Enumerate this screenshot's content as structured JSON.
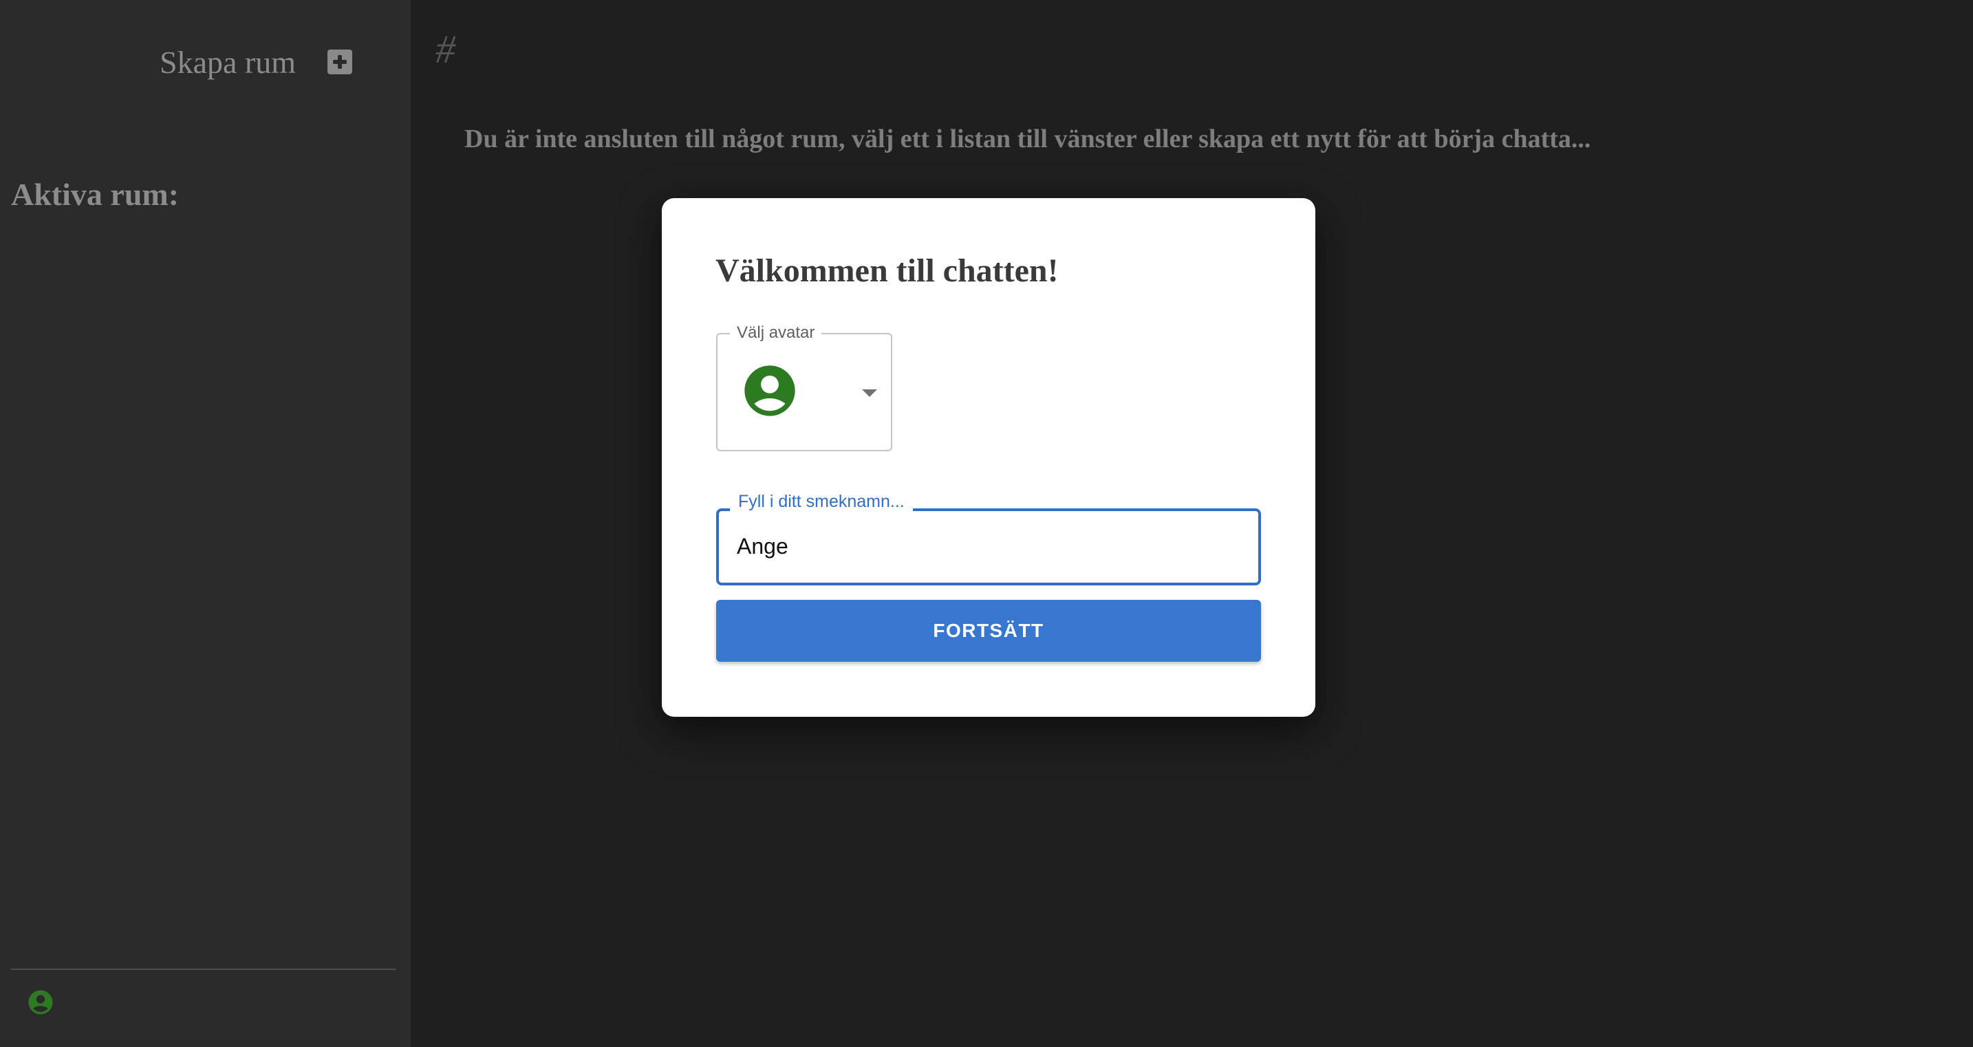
{
  "sidebar": {
    "create_room_label": "Skapa rum",
    "active_rooms_heading": "Aktiva rum:",
    "user_avatar_icon": "account-circle-icon",
    "user_avatar_color": "#2d7a22"
  },
  "main": {
    "channel_hash": "#",
    "not_connected_message": "Du är inte ansluten till något rum, välj ett i listan till vänster eller skapa ett nytt för att börja chatta..."
  },
  "modal": {
    "title": "Välkommen till chatten!",
    "avatar_select": {
      "label": "Välj avatar",
      "selected_icon": "account-circle-icon",
      "selected_color": "#2d7a22"
    },
    "nickname": {
      "label": "Fyll i ditt smeknamn...",
      "value": "Ange"
    },
    "continue_label": "FORTSÄTT",
    "accent_color": "#3777d0"
  }
}
